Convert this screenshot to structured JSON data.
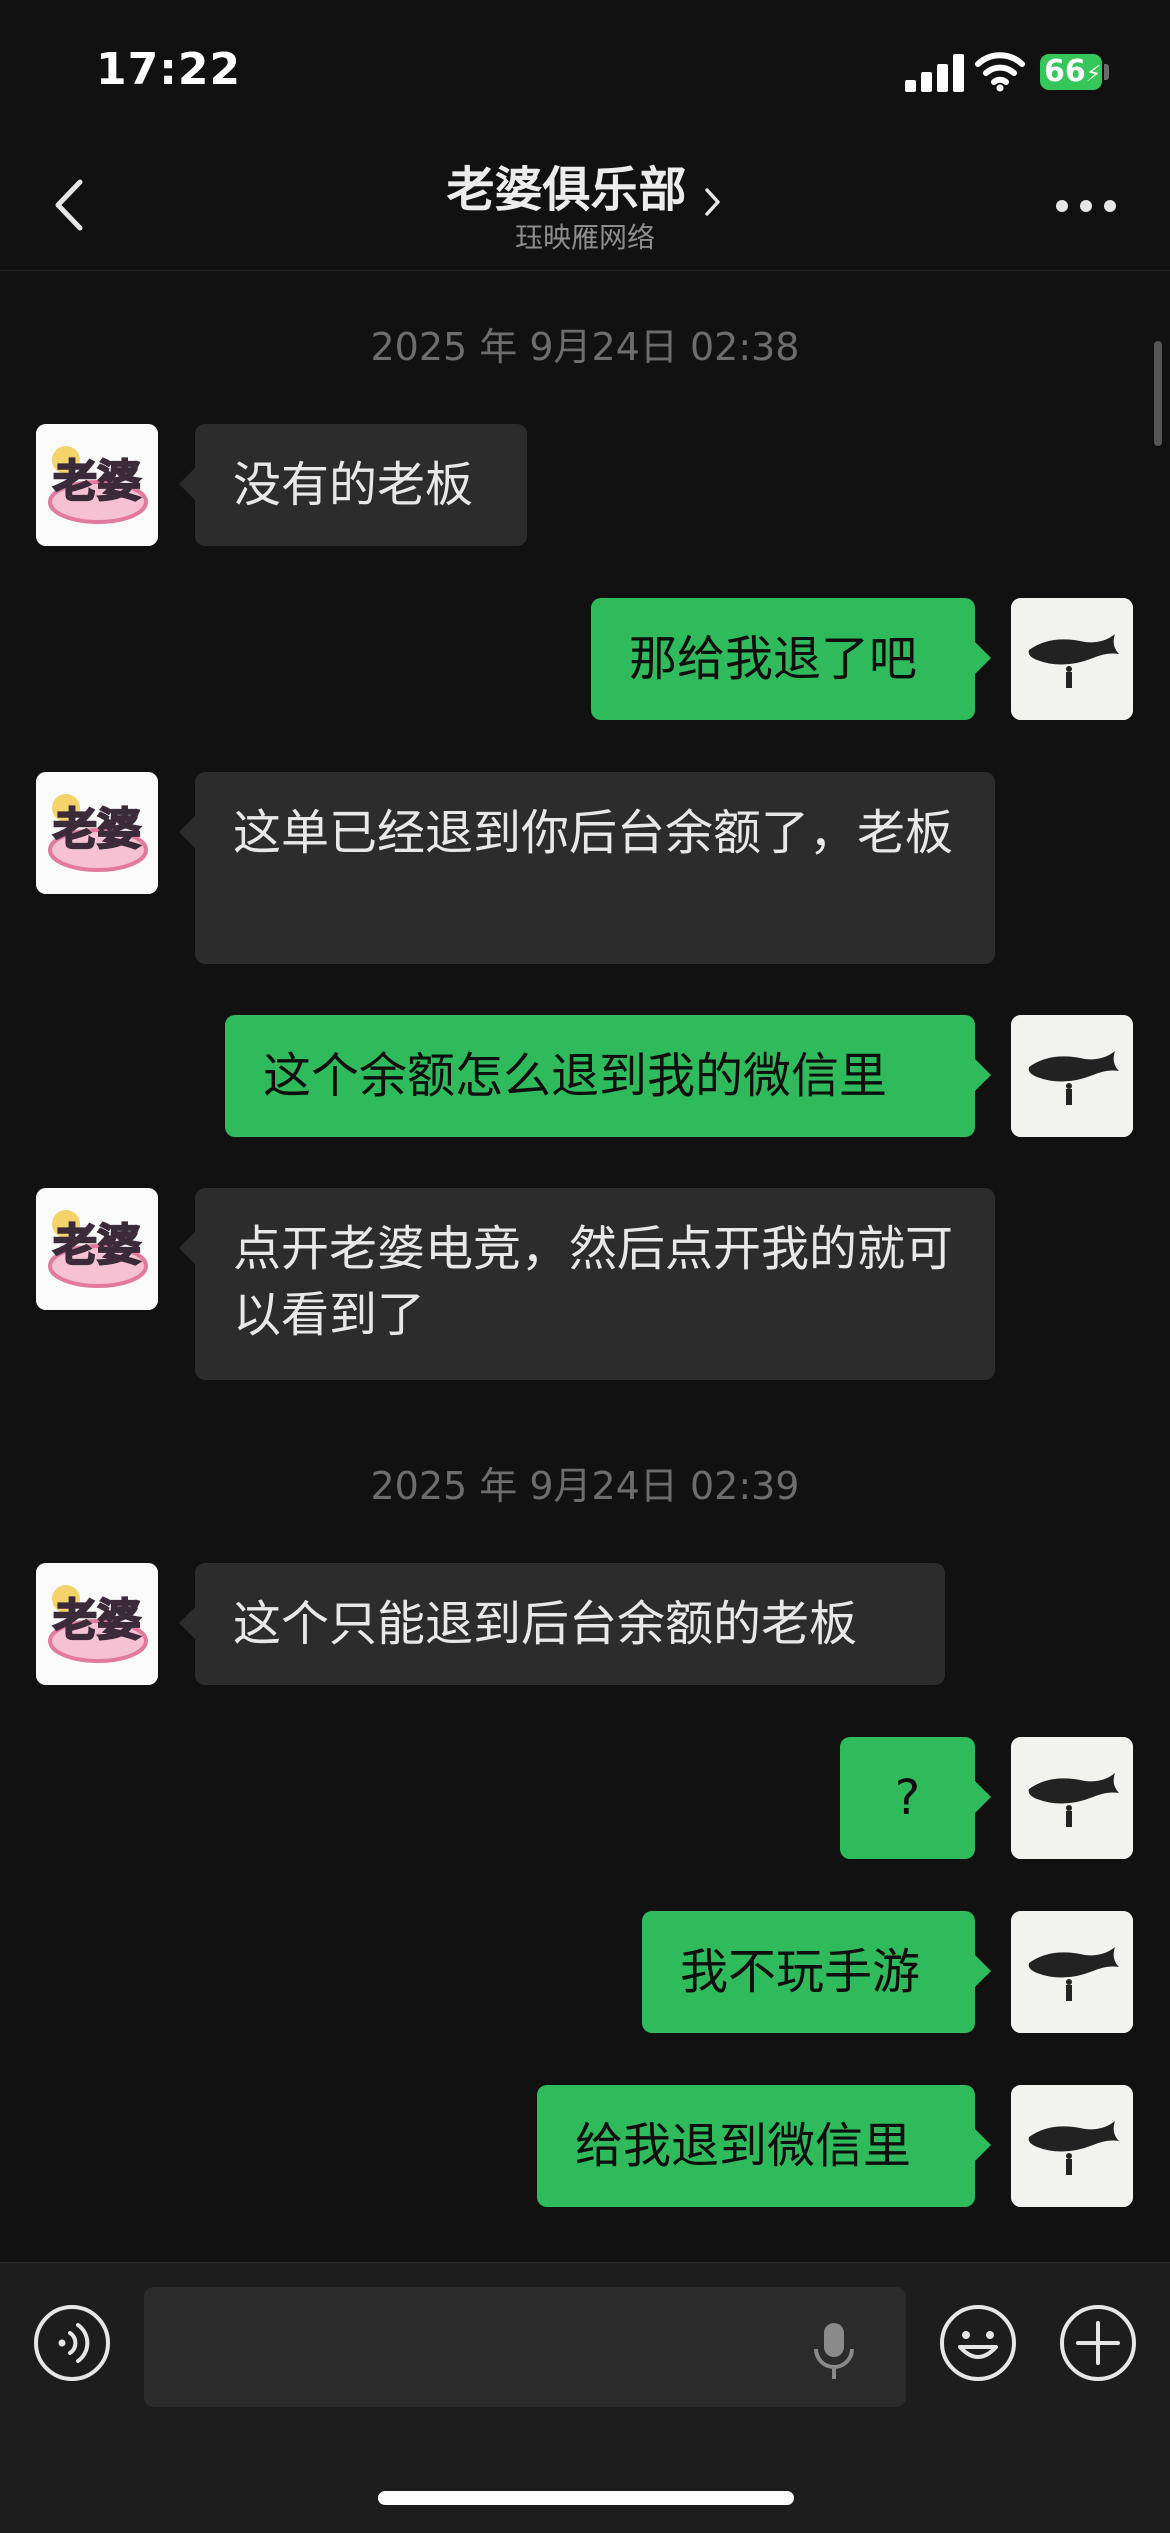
{
  "status_bar": {
    "time": "17:22",
    "battery": "66"
  },
  "header": {
    "title": "老婆俱乐部",
    "subtitle": "珏映雁网络"
  },
  "chat": {
    "timestamps": [
      "2025 年 9月24日 02:38",
      "2025 年 9月24日 02:39"
    ],
    "messages": [
      {
        "side": "in",
        "text": "没有的老板"
      },
      {
        "side": "out",
        "text": "那给我退了吧"
      },
      {
        "side": "in",
        "text": "这单已经退到你后台余额了，老板"
      },
      {
        "side": "out",
        "text": "这个余额怎么退到我的微信里"
      },
      {
        "side": "in",
        "text": "点开老婆电竞，然后点开我的就可以看到了"
      },
      {
        "side": "in",
        "text": "这个只能退到后台余额的老板"
      },
      {
        "side": "out",
        "text": "?"
      },
      {
        "side": "out",
        "text": "我不玩手游"
      },
      {
        "side": "out",
        "text": "给我退到微信里"
      }
    ]
  },
  "input_bar": {
    "placeholder": ""
  },
  "avatars": {
    "contact": "老婆",
    "self_icon": "whale-icon"
  },
  "colors": {
    "background": "#111111",
    "outgoing_bubble": "#2fba5c",
    "incoming_bubble": "#2c2c2c"
  }
}
